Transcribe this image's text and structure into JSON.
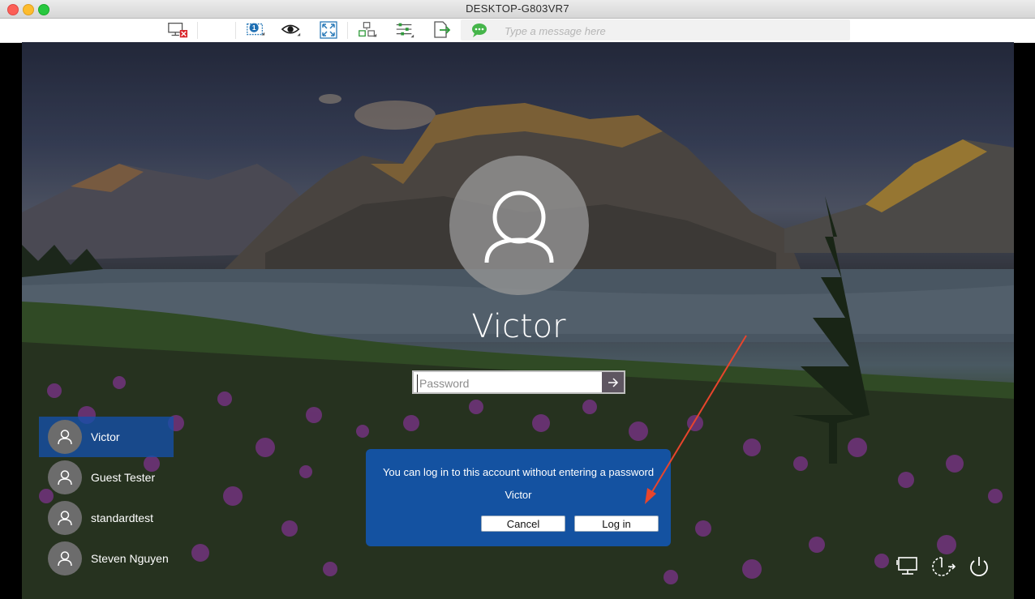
{
  "window": {
    "title": "DESKTOP-G803VR7"
  },
  "toolbar": {
    "icons": [
      "disconnect-icon",
      "monitor-select-icon",
      "view-icon",
      "fullscreen-icon",
      "actions-icon",
      "settings-icon",
      "file-transfer-icon",
      "chat-icon"
    ],
    "message_placeholder": "Type a message here"
  },
  "login": {
    "username": "Victor",
    "password_placeholder": "Password"
  },
  "users": [
    {
      "name": "Victor",
      "selected": true
    },
    {
      "name": "Guest Tester",
      "selected": false
    },
    {
      "name": "standardtest",
      "selected": false
    },
    {
      "name": "Steven Nguyen",
      "selected": false
    }
  ],
  "dialog": {
    "message": "You can log in to this account without entering a password",
    "user": "Victor",
    "cancel_label": "Cancel",
    "login_label": "Log in"
  },
  "corner_icons": [
    "network-icon",
    "ease-of-access-icon",
    "power-icon"
  ],
  "colors": {
    "accent_blue": "#1256b4",
    "annotation_arrow": "#e8452c"
  }
}
